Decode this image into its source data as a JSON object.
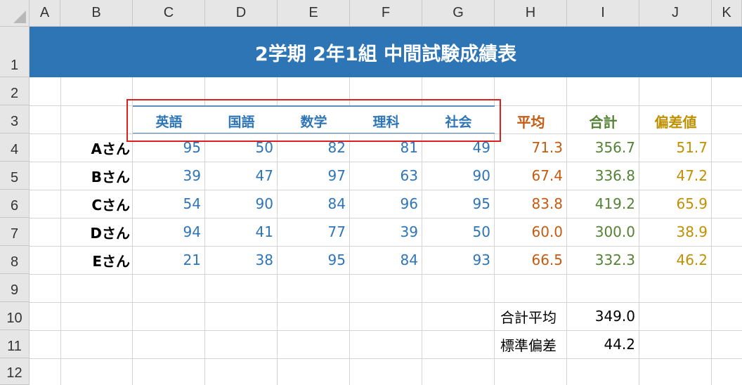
{
  "columns": [
    "A",
    "B",
    "C",
    "D",
    "E",
    "F",
    "G",
    "H",
    "I",
    "J",
    "K"
  ],
  "rows": [
    "1",
    "2",
    "3",
    "4",
    "5",
    "6",
    "7",
    "8",
    "9",
    "10",
    "11",
    "12"
  ],
  "title": "2学期 2年1組 中間試験成績表",
  "subjects": [
    "英語",
    "国語",
    "数学",
    "理科",
    "社会"
  ],
  "stat_headers": {
    "avg": "平均",
    "sum": "合計",
    "dev": "偏差値"
  },
  "students": [
    {
      "name": "Aさん",
      "scores": [
        "95",
        "50",
        "82",
        "81",
        "49"
      ],
      "avg": "71.3",
      "sum": "356.7",
      "dev": "51.7"
    },
    {
      "name": "Bさん",
      "scores": [
        "39",
        "47",
        "97",
        "63",
        "90"
      ],
      "avg": "67.4",
      "sum": "336.8",
      "dev": "47.2"
    },
    {
      "name": "Cさん",
      "scores": [
        "54",
        "90",
        "84",
        "96",
        "95"
      ],
      "avg": "83.8",
      "sum": "419.2",
      "dev": "65.9"
    },
    {
      "name": "Dさん",
      "scores": [
        "94",
        "41",
        "77",
        "39",
        "50"
      ],
      "avg": "60.0",
      "sum": "300.0",
      "dev": "38.9"
    },
    {
      "name": "Eさん",
      "scores": [
        "21",
        "38",
        "95",
        "84",
        "93"
      ],
      "avg": "66.5",
      "sum": "332.3",
      "dev": "46.2"
    }
  ],
  "summary": [
    {
      "label": "合計平均",
      "value": "349.0"
    },
    {
      "label": "標準偏差",
      "value": "44.2"
    }
  ],
  "colors": {
    "title_bg": "#2e75b6",
    "score": "#2e75b6",
    "avg": "#c55a11",
    "sum": "#548235",
    "dev": "#bf9000",
    "highlight": "#e02020"
  }
}
